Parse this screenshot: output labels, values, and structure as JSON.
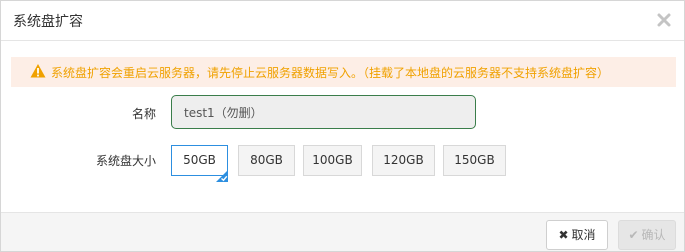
{
  "dialog": {
    "title": "系统盘扩容",
    "close_icon": "close-icon"
  },
  "warning": {
    "icon": "warning-icon",
    "text": "系统盘扩容会重启云服务器，请先停止云服务器数据写入。（挂载了本地盘的云服务器不支持系统盘扩容）",
    "color": "#f0a100",
    "background": "#fdeee6"
  },
  "form": {
    "name_label": "名称",
    "name_value": "test1（勿删）",
    "size_label": "系统盘大小",
    "size_options": [
      "50GB",
      "80GB",
      "100GB",
      "120GB",
      "150GB"
    ],
    "selected_size": "50GB",
    "accent_color": "#2d8fe0"
  },
  "footer": {
    "cancel_label": "取消",
    "cancel_icon": "times-icon",
    "confirm_label": "确认",
    "confirm_icon": "check-icon"
  }
}
